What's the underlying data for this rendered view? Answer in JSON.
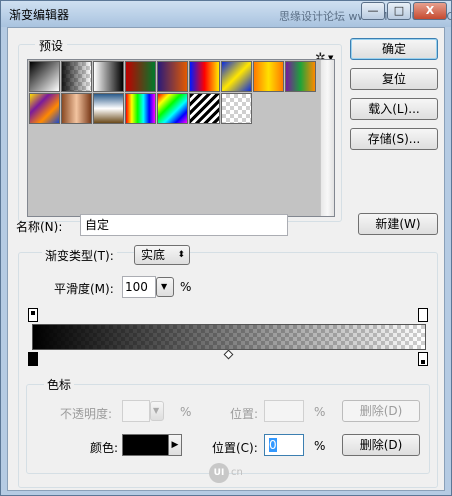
{
  "window": {
    "title": "渐变编辑器",
    "watermark": "思缘设计论坛 www.MISSYUAN.COM",
    "minimize_label": "—",
    "maximize_label": "□",
    "close_label": "X"
  },
  "presets": {
    "label": "预设",
    "gear_icon": "gear-icon",
    "swatches": [
      {
        "name": "black-white",
        "css": "linear-gradient(135deg,#000,#fff)"
      },
      {
        "name": "fg-transparent",
        "css": "checker"
      },
      {
        "name": "black-white-2",
        "css": "linear-gradient(90deg,#fff,#000)"
      },
      {
        "name": "red-green",
        "css": "linear-gradient(90deg,#c00000,#007a2b)"
      },
      {
        "name": "violet-orange",
        "css": "linear-gradient(90deg,#2a1a7a,#e35a00)"
      },
      {
        "name": "blue-red-yellow",
        "css": "linear-gradient(90deg,#0019ff,#ff0000,#ffea00)"
      },
      {
        "name": "blue-yellow-blue",
        "css": "linear-gradient(135deg,#0b2be0,#ffe600,#0b2be0)"
      },
      {
        "name": "orange-yellow-orange",
        "css": "linear-gradient(90deg,#ff7a00,#ffe000,#ff7a00)"
      },
      {
        "name": "violet-green-orange",
        "css": "linear-gradient(90deg,#7a1a9c,#1ea33a,#ff8a00)"
      },
      {
        "name": "yellow-violet-orange-blue",
        "css": "linear-gradient(135deg,#ffde00,#7a1a9c,#ff8a00,#1a4ad0)"
      },
      {
        "name": "copper",
        "css": "linear-gradient(90deg,#8a4a24,#f3c4a0,#7a3a1a)"
      },
      {
        "name": "chrome",
        "css": "linear-gradient(180deg,#2a5a8a,#ffffff,#6a4a1a)"
      },
      {
        "name": "spectrum",
        "css": "linear-gradient(90deg,#ff0000,#ffff00,#00ff00,#00ffff,#0000ff,#ff00ff)"
      },
      {
        "name": "transparent-rainbow",
        "css": "linear-gradient(135deg,#ff0000,#ffff00,#00ff00,#00ffff,#0000ff,#ff00ff)"
      },
      {
        "name": "transparent-stripes",
        "css": "repeating-linear-gradient(135deg,#000 0 3px,#fff 3px 6px)"
      },
      {
        "name": "transparent",
        "css": "checker"
      }
    ]
  },
  "buttons": {
    "ok": "确定",
    "reset": "复位",
    "load": "载入(L)...",
    "save": "存储(S)..."
  },
  "name_row": {
    "label": "名称(N):",
    "value": "自定",
    "new_button": "新建(W)"
  },
  "gradient": {
    "type_label": "渐变类型(T):",
    "type_value": "实底",
    "smoothness_label": "平滑度(M):",
    "smoothness_value": "100",
    "smoothness_unit": "%",
    "start_color": "#000000"
  },
  "stops": {
    "label": "色标",
    "opacity_label": "不透明度:",
    "opacity_unit": "%",
    "opacity_position_label": "位置:",
    "opacity_position_unit": "%",
    "opacity_delete": "删除(D)",
    "color_label": "颜色:",
    "color_value": "#000000",
    "color_position_label": "位置(C):",
    "color_position_value": "0",
    "color_position_unit": "%",
    "color_delete": "删除(D)"
  },
  "footer": {
    "logo_text": "UI",
    "logo_caption": "cn"
  }
}
